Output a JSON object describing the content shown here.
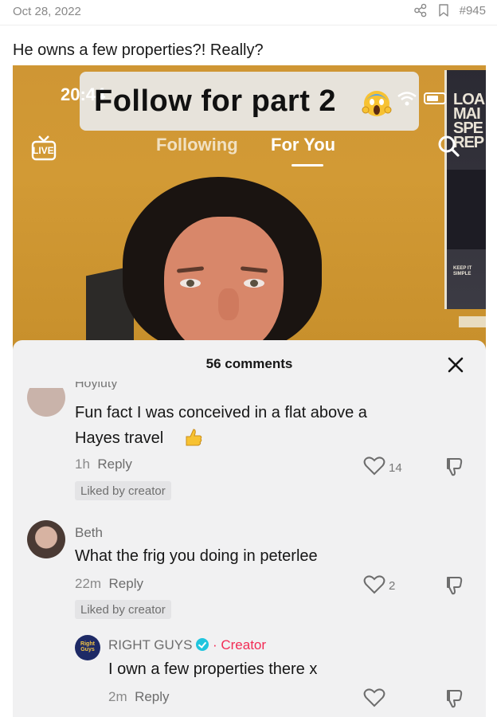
{
  "post": {
    "date": "Oct 28, 2022",
    "number": "#945",
    "title": "He owns a few properties?! Really?"
  },
  "video": {
    "status_time": "20:44",
    "caption": "Follow for part 2",
    "tabs": {
      "following": "Following",
      "for_you": "For You"
    },
    "live_label": "LIVE",
    "poster_text": [
      "LOA",
      "MAI",
      "SPE",
      "REP"
    ],
    "poster_small": "KEEP IT SIMPLE"
  },
  "comments": {
    "count_label": "56 comments",
    "items": [
      {
        "name_cut": "Hoyiuty",
        "text_lines": [
          "Fun fact I was conceived in a flat above a",
          "Hayes travel"
        ],
        "time": "1h",
        "reply": "Reply",
        "likes": "14",
        "liked_by": "Liked by creator"
      },
      {
        "name": "Beth",
        "text_lines": [
          "What the frig you doing in peterlee"
        ],
        "time": "22m",
        "reply": "Reply",
        "likes": "2",
        "liked_by": "Liked by creator"
      },
      {
        "name": "RIGHT GUYS",
        "creator_label": "Creator",
        "separator": "·",
        "avatar_text": "Right Guys",
        "text_lines": [
          "I own a few properties there x"
        ],
        "time": "2m",
        "reply": "Reply"
      }
    ]
  },
  "colors": {
    "accent_creator": "#f22c55",
    "verified": "#20c5de",
    "sheet_bg": "#f1f1f2"
  }
}
